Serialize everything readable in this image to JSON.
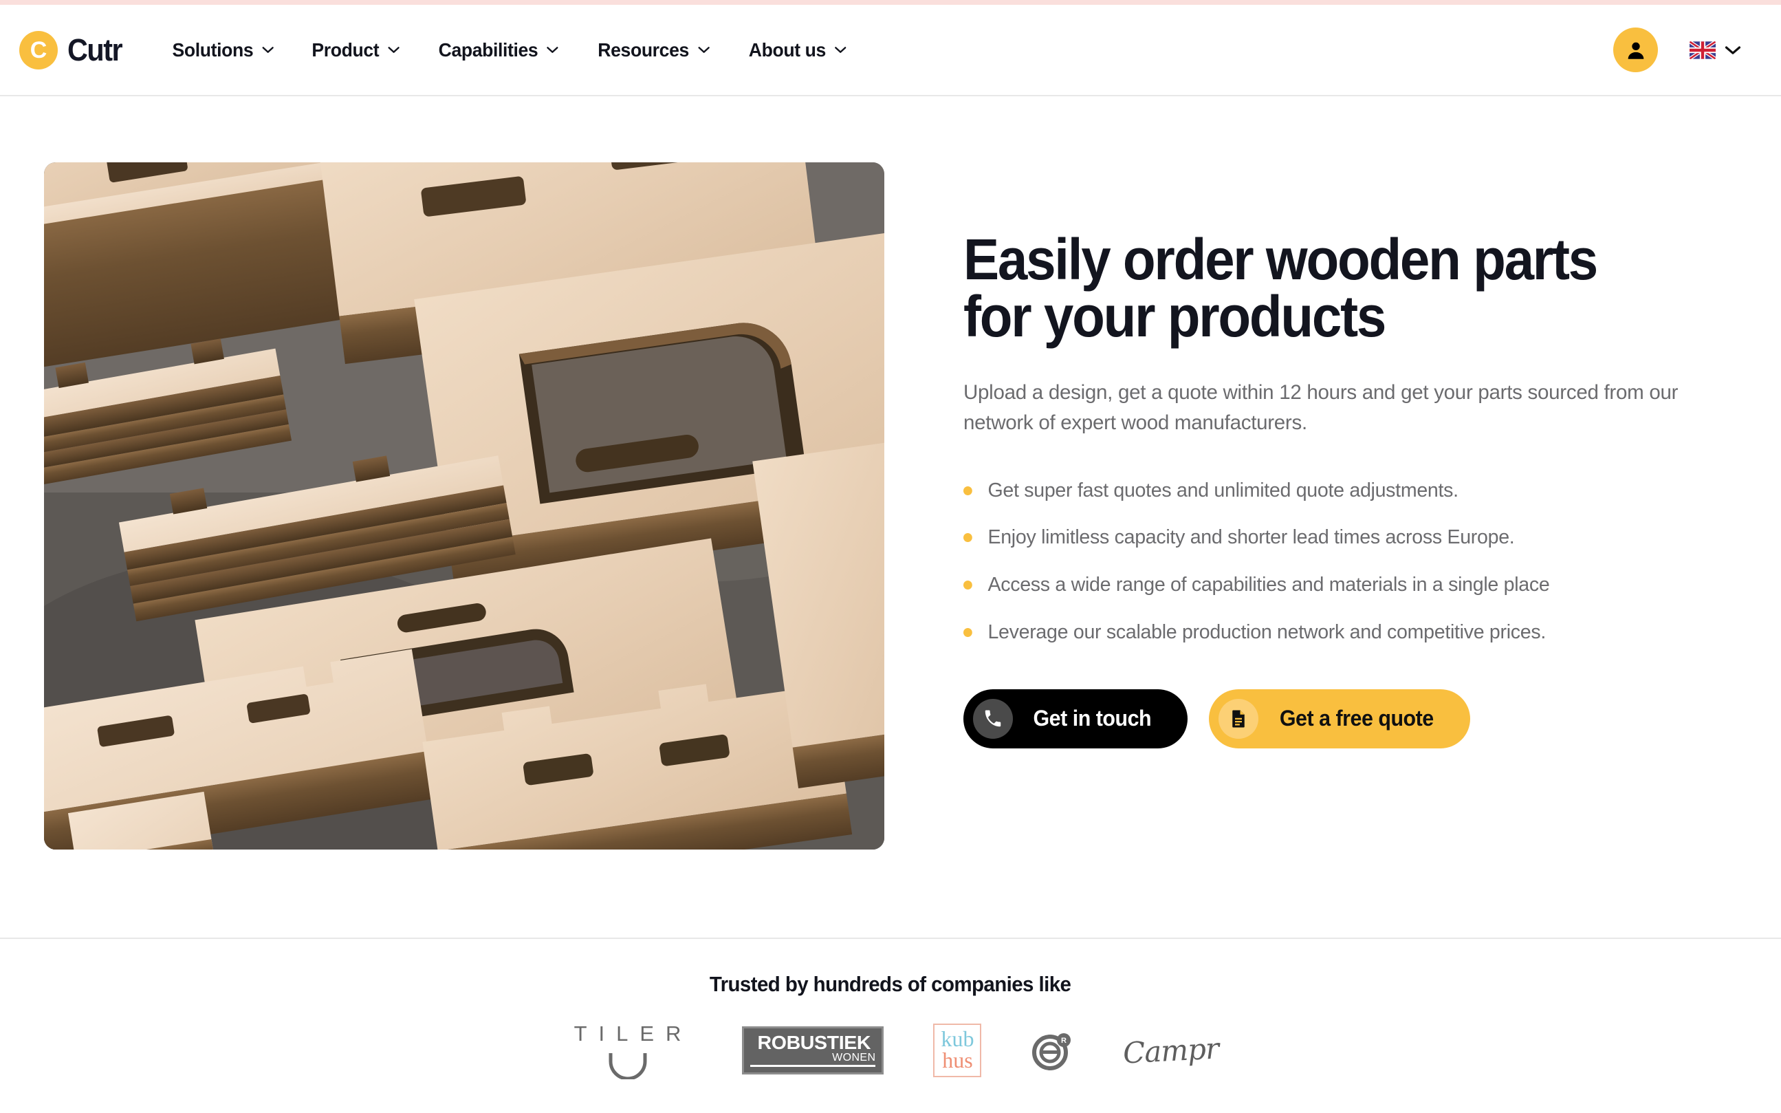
{
  "brand": {
    "name": "Cutr",
    "mark_letter": "C",
    "mark_color": "#f9bf3f",
    "word_color": "#141726"
  },
  "nav": {
    "items": [
      {
        "label": "Solutions",
        "icon": "chevron-down-icon"
      },
      {
        "label": "Product",
        "icon": "chevron-down-icon"
      },
      {
        "label": "Capabilities",
        "icon": "chevron-down-icon"
      },
      {
        "label": "Resources",
        "icon": "chevron-down-icon"
      },
      {
        "label": "About us",
        "icon": "chevron-down-icon"
      }
    ]
  },
  "header_right": {
    "account_icon": "person-icon",
    "account_bg": "#f9bf3f",
    "language_flag": "uk-flag-icon",
    "language_chevron": "chevron-down-icon"
  },
  "hero": {
    "image_alt": "cnc-cut-plywood-parts",
    "title": "Easily order wooden parts\nfor your products",
    "subtitle": "Upload a design, get a quote within 12 hours and get your parts sourced from our network of expert wood manufacturers.",
    "bullets": [
      "Get super fast quotes and unlimited quote adjustments.",
      "Enjoy limitless capacity and shorter lead times across Europe.",
      "Access a wide range of capabilities and materials in a single place",
      "Leverage our scalable production network and competitive prices."
    ],
    "bullet_color": "#f9bf3f",
    "cta": {
      "primary": {
        "label": "Get in touch",
        "icon": "phone-icon",
        "bg": "#000000",
        "text_color": "#ffffff"
      },
      "secondary": {
        "label": "Get a free quote",
        "icon": "document-icon",
        "bg": "#f9bf3f",
        "text_color": "#101010"
      }
    }
  },
  "trusted": {
    "title": "Trusted by hundreds of companies like",
    "logos": [
      {
        "name": "TILER",
        "type": "tiler"
      },
      {
        "name": "ROBUSTIEK WONEN",
        "main": "ROBUSTIEK",
        "sub": "WONEN",
        "type": "robustiek"
      },
      {
        "name": "kub hus",
        "line1": "kub",
        "line2": "hus",
        "type": "kubhus",
        "color1": "#7ec8dc",
        "color2": "#ef8f74"
      },
      {
        "name": "circle-r-mark",
        "type": "circle"
      },
      {
        "name": "Campr",
        "label": "Campr",
        "type": "campr"
      }
    ]
  }
}
